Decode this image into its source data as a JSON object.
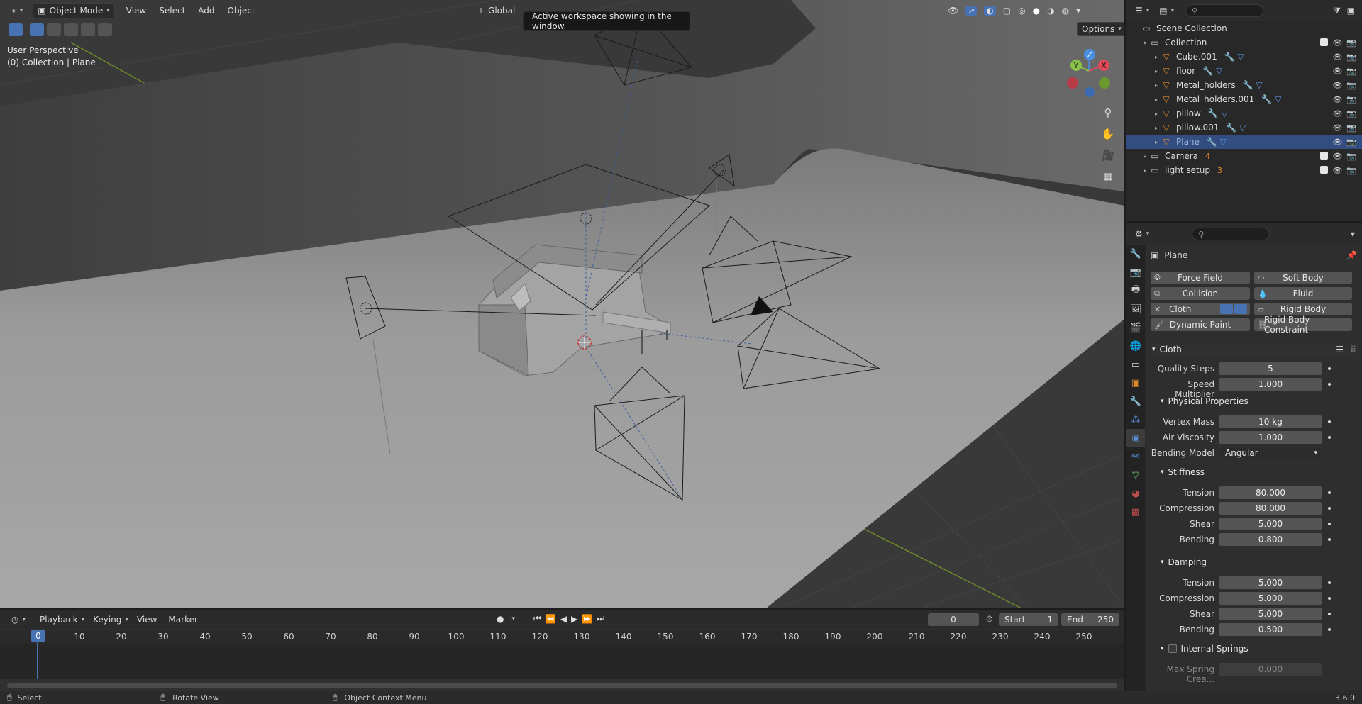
{
  "viewport": {
    "header": {
      "mode_label": "Object Mode",
      "menus": [
        "View",
        "Select",
        "Add",
        "Object"
      ],
      "transform_orientation": "Global",
      "options_label": "Options"
    },
    "tooltip": "Active workspace showing in the window.",
    "perspective_label": "User Perspective",
    "collection_label": "(0) Collection | Plane",
    "gizmo_axes": [
      "Z",
      "Y",
      "X"
    ]
  },
  "timeline": {
    "menus": [
      "Playback",
      "Keying",
      "View",
      "Marker"
    ],
    "current_frame": "0",
    "start_label": "Start",
    "start_value": "1",
    "end_label": "End",
    "end_value": "250",
    "ruler": [
      "0",
      "10",
      "20",
      "30",
      "40",
      "50",
      "60",
      "70",
      "80",
      "90",
      "100",
      "110",
      "120",
      "130",
      "140",
      "150",
      "160",
      "170",
      "180",
      "190",
      "200",
      "210",
      "220",
      "230",
      "240",
      "250"
    ]
  },
  "statusbar": {
    "items": [
      "Select",
      "Rotate View",
      "Object Context Menu"
    ],
    "version": "3.6.0"
  },
  "outliner": {
    "rows": [
      {
        "label": "Scene Collection",
        "icon": "scene-collection-icon"
      },
      {
        "label": "Collection",
        "icon": "collection-icon"
      },
      {
        "label": "Cube.001",
        "icon": "mesh-object-icon"
      },
      {
        "label": "floor",
        "icon": "mesh-object-icon"
      },
      {
        "label": "Metal_holders",
        "icon": "mesh-object-icon"
      },
      {
        "label": "Metal_holders.001",
        "icon": "mesh-object-icon"
      },
      {
        "label": "pillow",
        "icon": "mesh-object-icon"
      },
      {
        "label": "pillow.001",
        "icon": "mesh-object-icon"
      },
      {
        "label": "Plane",
        "icon": "mesh-object-icon"
      },
      {
        "label": "Camera",
        "icon": "collection-icon",
        "badge": "4"
      },
      {
        "label": "light setup",
        "icon": "collection-icon",
        "badge": "3"
      }
    ]
  },
  "properties": {
    "object_name": "Plane",
    "physics_buttons": {
      "force_field": "Force Field",
      "soft_body": "Soft Body",
      "collision": "Collision",
      "fluid": "Fluid",
      "cloth": "Cloth",
      "rigid_body": "Rigid Body",
      "dynamic_paint": "Dynamic Paint",
      "rigid_body_constraint": "Rigid Body Constraint"
    },
    "cloth_panel": {
      "title": "Cloth",
      "quality_steps_label": "Quality Steps",
      "quality_steps": "5",
      "speed_multiplier_label": "Speed Multiplier",
      "speed_multiplier": "1.000"
    },
    "physical": {
      "title": "Physical Properties",
      "vertex_mass_label": "Vertex Mass",
      "vertex_mass": "10 kg",
      "air_viscosity_label": "Air Viscosity",
      "air_viscosity": "1.000",
      "bending_model_label": "Bending Model",
      "bending_model": "Angular"
    },
    "stiffness": {
      "title": "Stiffness",
      "tension_label": "Tension",
      "tension": "80.000",
      "compression_label": "Compression",
      "compression": "80.000",
      "shear_label": "Shear",
      "shear": "5.000",
      "bending_label": "Bending",
      "bending": "0.800"
    },
    "damping": {
      "title": "Damping",
      "tension_label": "Tension",
      "tension": "5.000",
      "compression_label": "Compression",
      "compression": "5.000",
      "shear_label": "Shear",
      "shear": "5.000",
      "bending_label": "Bending",
      "bending": "0.500"
    },
    "internal_springs": {
      "title": "Internal Springs",
      "max_spring_label": "Max Spring Crea...",
      "max_spring": "0.000"
    }
  },
  "colors": {
    "accent": "#4772b3",
    "selected_row": "#334d80",
    "axis_x": "#e24a5a",
    "axis_y": "#8bc34a",
    "axis_z": "#4a90e2"
  }
}
